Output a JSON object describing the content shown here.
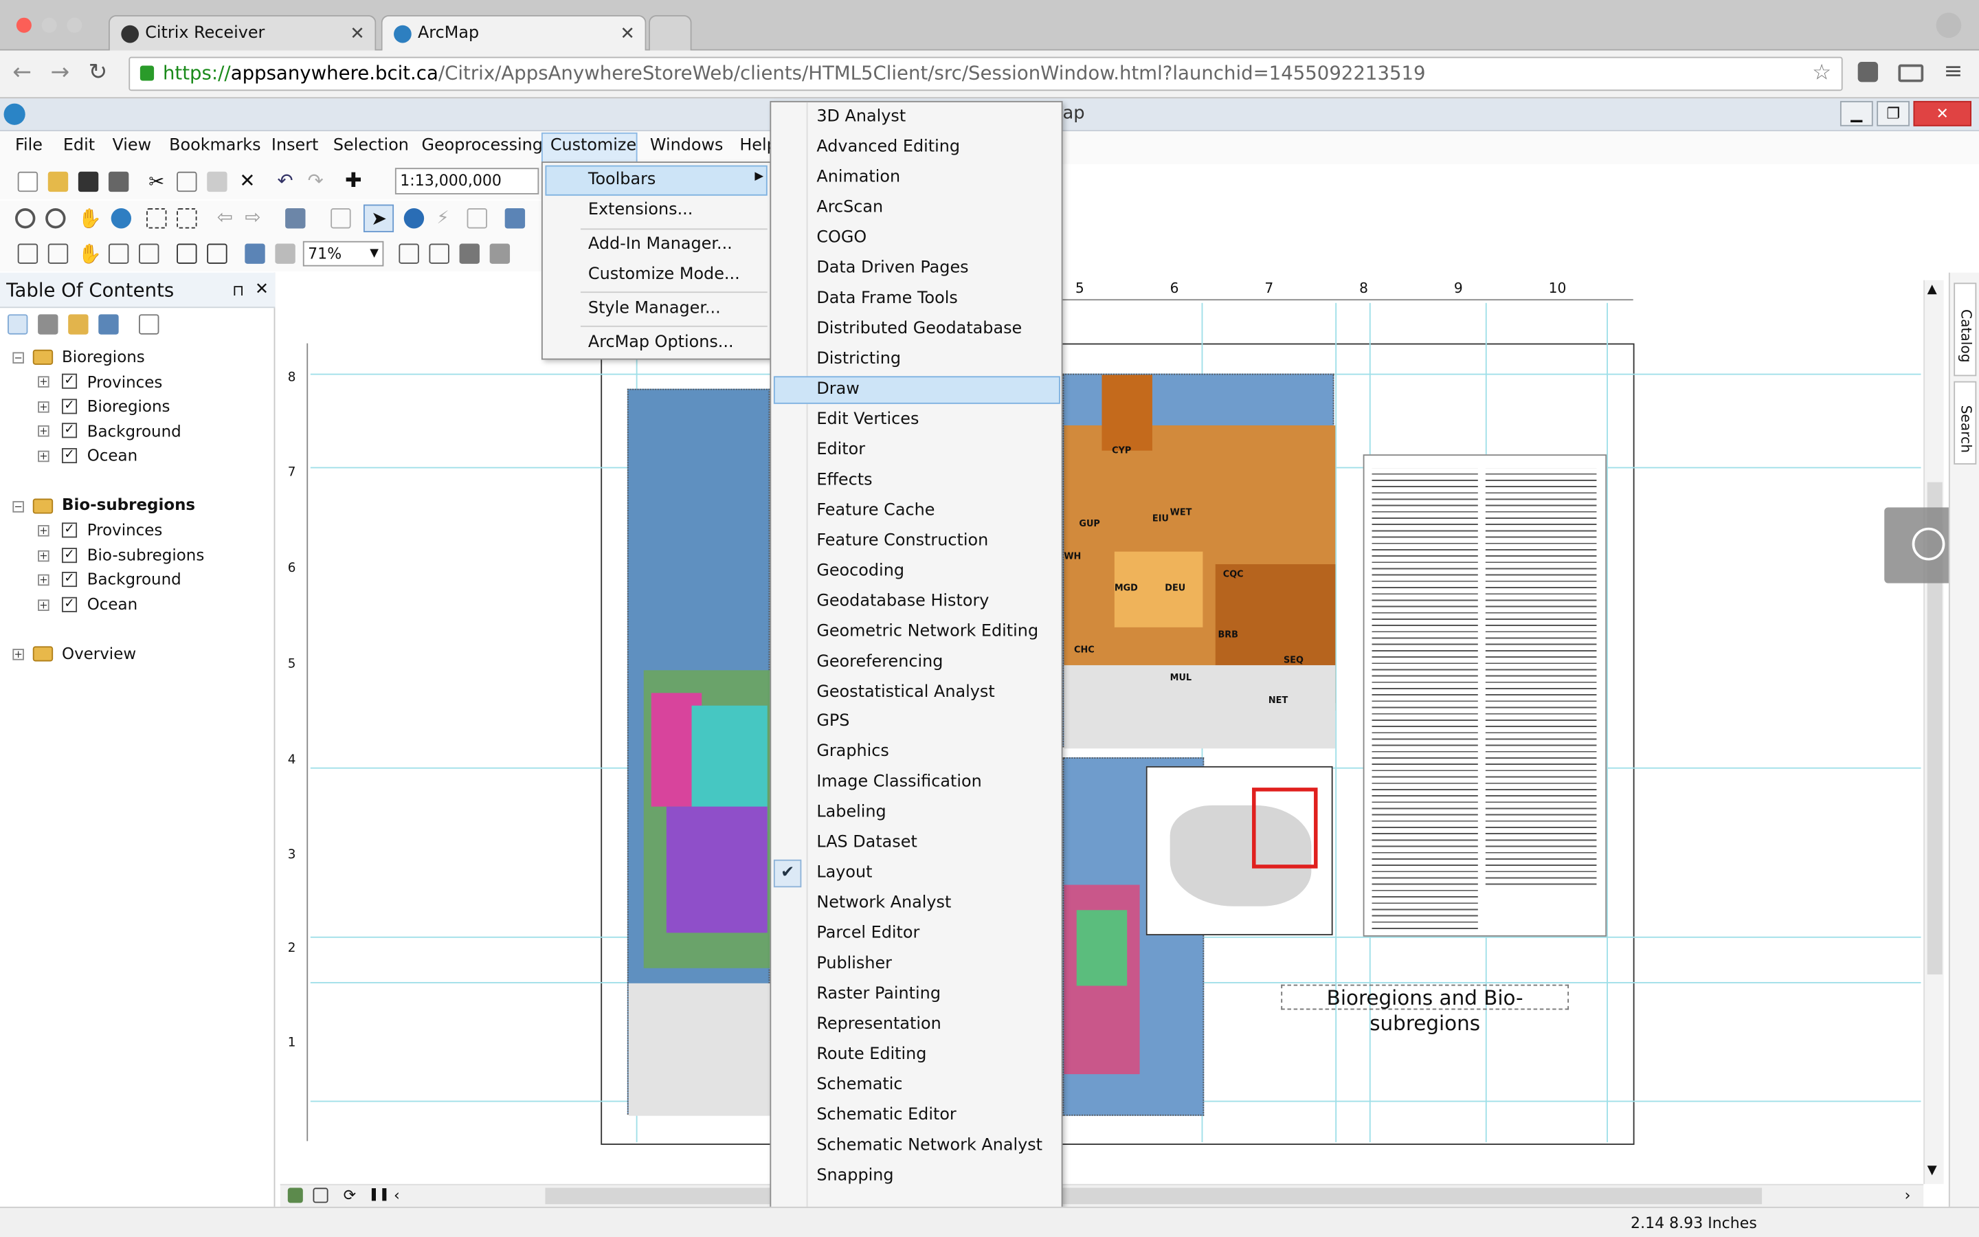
{
  "browser": {
    "tabs": [
      {
        "label": "Citrix Receiver"
      },
      {
        "label": "ArcMap"
      }
    ],
    "url": {
      "scheme": "https://",
      "host": "appsanywhere.bcit.ca",
      "path": "/Citrix/AppsAnywhereStoreWeb/clients/HTML5Client/src/SessionWindow.html?launchid=1455092213519"
    }
  },
  "arcmap": {
    "title_fragment": "ap",
    "menu": [
      "File",
      "Edit",
      "View",
      "Bookmarks",
      "Insert",
      "Selection",
      "Geoprocessing",
      "Customize",
      "Windows",
      "Help"
    ],
    "scale": "1:13,000,000",
    "zoom": "71%",
    "customize_menu": [
      {
        "label": "Toolbars",
        "has_submenu": true
      },
      {
        "label": "Extensions..."
      },
      {
        "label": "Add-In Manager..."
      },
      {
        "label": "Customize Mode..."
      },
      {
        "label": "Style Manager..."
      },
      {
        "label": "ArcMap Options..."
      }
    ],
    "toolbars_submenu": [
      "3D Analyst",
      "Advanced Editing",
      "Animation",
      "ArcScan",
      "COGO",
      "Data Driven Pages",
      "Data Frame Tools",
      "Distributed Geodatabase",
      "Districting",
      "Draw",
      "Edit Vertices",
      "Editor",
      "Effects",
      "Feature Cache",
      "Feature Construction",
      "Geocoding",
      "Geodatabase History",
      "Geometric Network Editing",
      "Georeferencing",
      "Geostatistical Analyst",
      "GPS",
      "Graphics",
      "Image Classification",
      "Labeling",
      "LAS Dataset",
      "Layout",
      "Network Analyst",
      "Parcel Editor",
      "Publisher",
      "Raster Painting",
      "Representation",
      "Route Editing",
      "Schematic",
      "Schematic Editor",
      "Schematic Network Analyst",
      "Snapping"
    ],
    "highlighted_item": "Draw",
    "checked_item": "Layout",
    "toc": {
      "title": "Table Of Contents",
      "groups": [
        {
          "name": "Bioregions",
          "layers": [
            "Provinces",
            "Bioregions",
            "Background",
            "Ocean"
          ]
        },
        {
          "name": "Bio-subregions",
          "layers": [
            "Provinces",
            "Bio-subregions",
            "Background",
            "Ocean"
          ]
        },
        {
          "name": "Overview",
          "layers": []
        }
      ]
    },
    "ruler_h": [
      "5",
      "6",
      "7",
      "8",
      "9",
      "10"
    ],
    "ruler_v": [
      "8",
      "7",
      "6",
      "5",
      "4",
      "3",
      "2",
      "1"
    ],
    "map_title": "Bioregions and Bio-subregions",
    "map_labels": [
      "CYP",
      "GUP",
      "EIU",
      "WET",
      "WH",
      "MGD",
      "DEU",
      "CQC",
      "BRB",
      "CHC",
      "MUL",
      "SEQ",
      "NET"
    ],
    "side_tabs": [
      "Catalog",
      "Search"
    ],
    "status": "2.14  8.93 Inches"
  },
  "colors": {
    "selection": "#cde4f7",
    "guide": "#9fdfe8",
    "inset_box": "#e0201e"
  }
}
